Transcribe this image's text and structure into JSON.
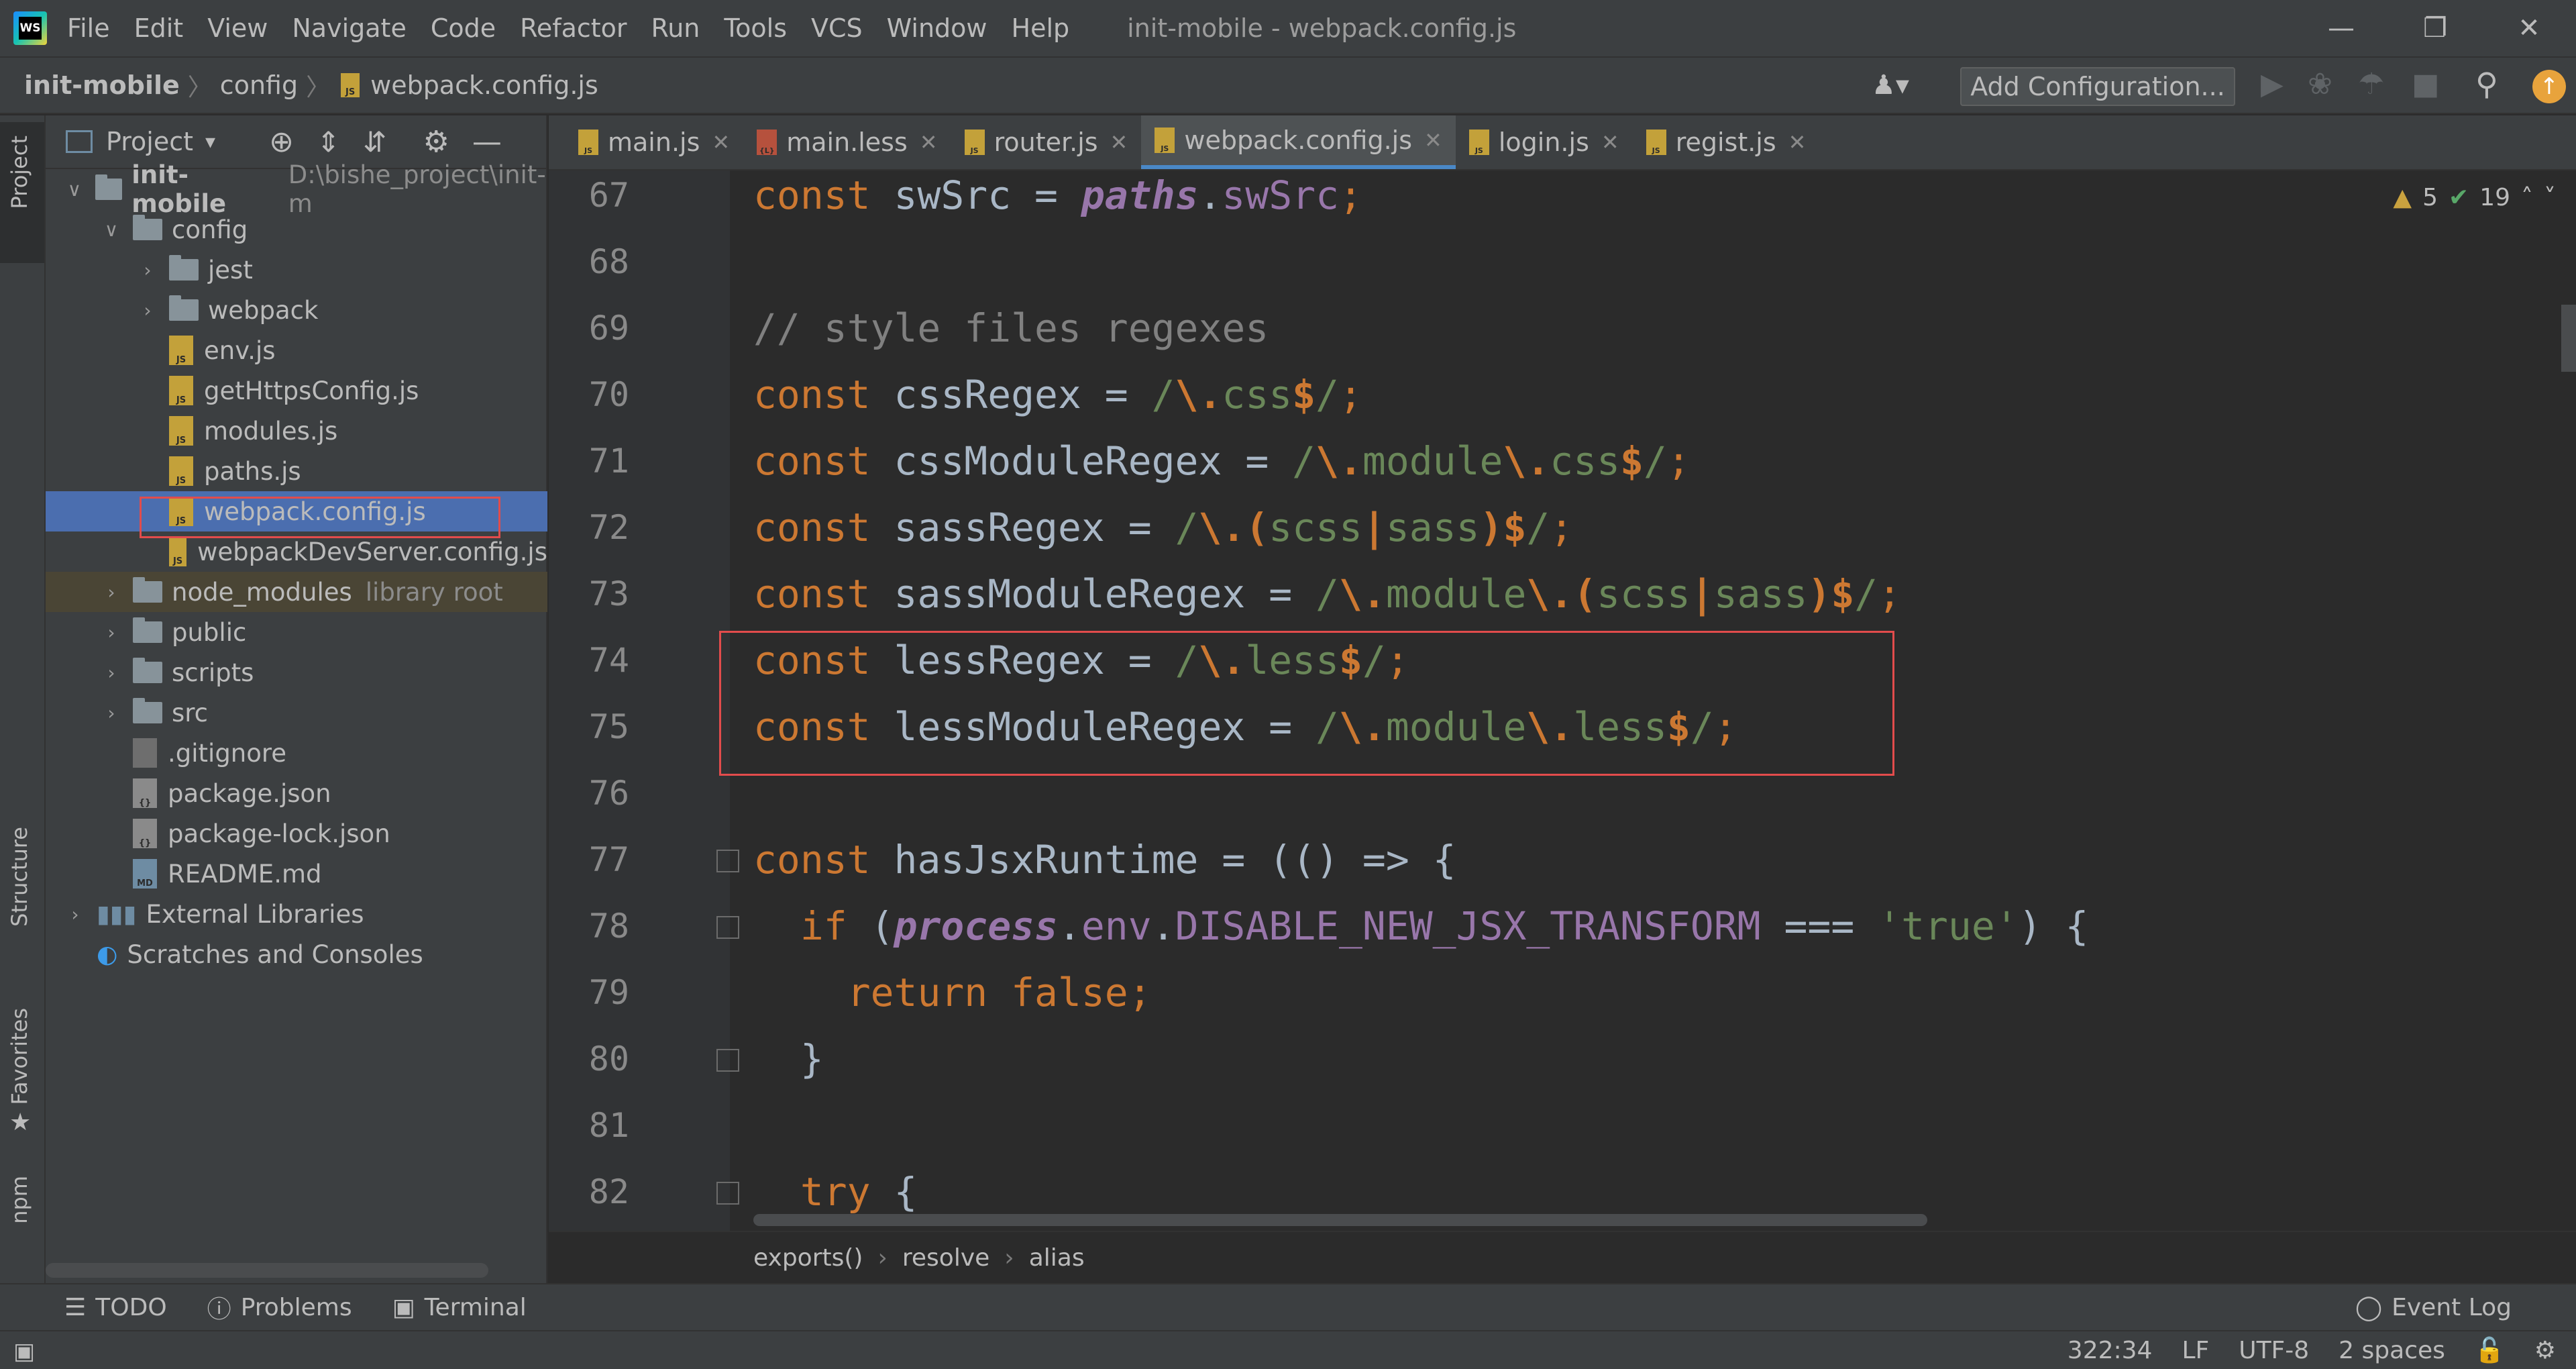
{
  "menubar": {
    "logo": "WS",
    "items": [
      "File",
      "Edit",
      "View",
      "Navigate",
      "Code",
      "Refactor",
      "Run",
      "Tools",
      "VCS",
      "Window",
      "Help"
    ],
    "window_title": "init-mobile - webpack.config.js"
  },
  "navbar": {
    "crumbs": [
      "init-mobile",
      "config",
      "webpack.config.js"
    ],
    "add_configuration": "Add Configuration..."
  },
  "left_strip": {
    "project": "Project",
    "structure": "Structure",
    "favorites": "Favorites",
    "npm": "npm"
  },
  "project_panel": {
    "title": "Project",
    "tree": [
      {
        "label": "init-mobile",
        "extra": "D:\\bishe_project\\init-m"
      },
      {
        "label": "config"
      },
      {
        "label": "jest"
      },
      {
        "label": "webpack"
      },
      {
        "label": "env.js"
      },
      {
        "label": "getHttpsConfig.js"
      },
      {
        "label": "modules.js"
      },
      {
        "label": "paths.js"
      },
      {
        "label": "webpack.config.js"
      },
      {
        "label": "webpackDevServer.config.js"
      },
      {
        "label": "node_modules",
        "extra": "library root"
      },
      {
        "label": "public"
      },
      {
        "label": "scripts"
      },
      {
        "label": "src"
      },
      {
        "label": ".gitignore"
      },
      {
        "label": "package.json"
      },
      {
        "label": "package-lock.json"
      },
      {
        "label": "README.md"
      },
      {
        "label": "External Libraries"
      },
      {
        "label": "Scratches and Consoles"
      }
    ]
  },
  "tabs": [
    {
      "label": "main.js"
    },
    {
      "label": "main.less"
    },
    {
      "label": "router.js"
    },
    {
      "label": "webpack.config.js"
    },
    {
      "label": "login.js"
    },
    {
      "label": "regist.js"
    }
  ],
  "editor": {
    "warnings": "5",
    "checks": "19",
    "line_numbers": [
      "67",
      "68",
      "69",
      "70",
      "71",
      "72",
      "73",
      "74",
      "75",
      "76",
      "77",
      "78",
      "79",
      "80",
      "81",
      "82"
    ]
  },
  "breadcrumbs": [
    "exports()",
    "resolve",
    "alias"
  ],
  "bottom_tools": {
    "todo": "TODO",
    "problems": "Problems",
    "terminal": "Terminal",
    "event_log": "Event Log"
  },
  "status": {
    "position": "322:34",
    "line_sep": "LF",
    "encoding": "UTF-8",
    "indent": "2 spaces"
  },
  "colors": {
    "accent": "#4a88c7",
    "selection": "#4b6eaf",
    "highlight_box": "#e24c4c"
  }
}
